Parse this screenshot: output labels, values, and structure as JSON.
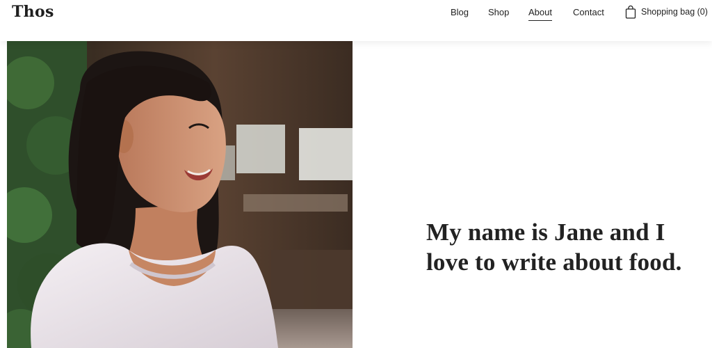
{
  "header": {
    "logo": "Thos",
    "nav": [
      {
        "label": "Blog",
        "active": false
      },
      {
        "label": "Shop",
        "active": false
      },
      {
        "label": "About",
        "active": true
      },
      {
        "label": "Contact",
        "active": false
      }
    ],
    "cart": {
      "icon": "shopping-bag-icon",
      "label": "Shopping bag (0)"
    }
  },
  "hero": {
    "intro_text": "My name is Jane and I love to write about food."
  }
}
